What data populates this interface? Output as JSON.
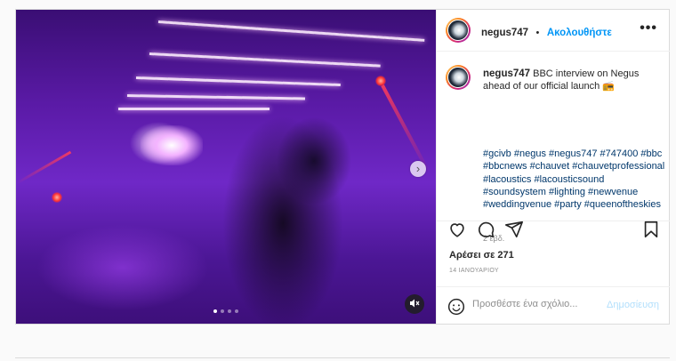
{
  "post": {
    "username": "negus747",
    "separator": "•",
    "follow_label": "Ακολουθήστε",
    "more_label": "•••",
    "caption": "BBC interview on Negus ahead of our official launch 📻",
    "hashtags": "#gcivb #negus #negus747 #747400 #bbc #bbcnews #chauvet #chauvetprofessional #lacoustics #lacousticsound #soundsystem #lighting #newvenue #weddingvenue #party #queenoftheskies",
    "age": "2 εβδ.",
    "likes": "Αρέσει σε 271",
    "date": "14 ΙΑΝΟΥΑΡΙΟΥ",
    "comment_placeholder": "Προσθέστε ένα σχόλιο...",
    "post_label": "Δημοσίευση"
  },
  "media": {
    "carousel_count": 4,
    "carousel_active_index": 0,
    "next_icon": "chevron-right-icon",
    "mute_icon": "speaker-muted-icon"
  },
  "icons": {
    "like": "heart-icon",
    "comment": "comment-icon",
    "share": "send-icon",
    "save": "bookmark-icon",
    "emoji": "emoji-icon"
  },
  "colors": {
    "link_blue": "#0095f6",
    "hashtag": "#00376b",
    "post_disabled": "#b2dffc",
    "border": "#dbdbdb"
  }
}
